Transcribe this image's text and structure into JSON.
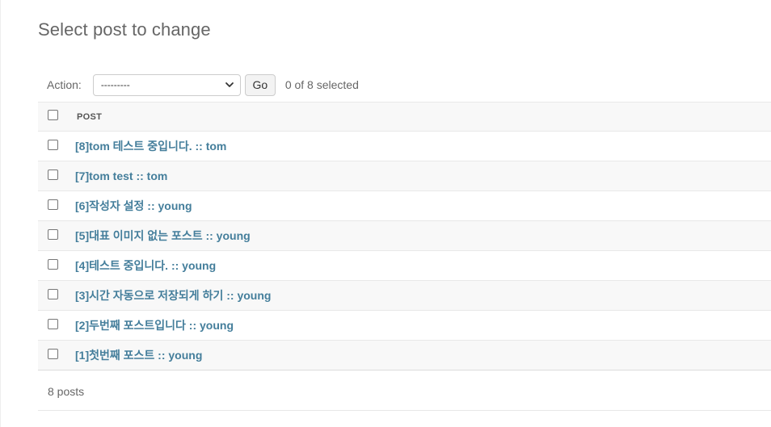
{
  "page": {
    "title": "Select post to change"
  },
  "actions": {
    "label": "Action:",
    "select_value": "---------",
    "go_label": "Go",
    "selected_count": "0 of 8 selected"
  },
  "table": {
    "column_header": "POST",
    "rows": [
      {
        "label": "[8]tom 테스트 중입니다. :: tom"
      },
      {
        "label": "[7]tom test :: tom"
      },
      {
        "label": "[6]작성자 설정 :: young"
      },
      {
        "label": "[5]대표 이미지 없는 포스트 :: young"
      },
      {
        "label": "[4]테스트 중입니다. :: young"
      },
      {
        "label": "[3]시간 자동으로 저장되게 하기 :: young"
      },
      {
        "label": "[2]두번째 포스트입니다 :: young"
      },
      {
        "label": "[1]첫번째 포스트 :: young"
      }
    ]
  },
  "footer": {
    "count": "8 posts"
  },
  "colors": {
    "link": "#447e9b",
    "row_alt": "#f8f8f8",
    "border": "#e8e8e8"
  }
}
